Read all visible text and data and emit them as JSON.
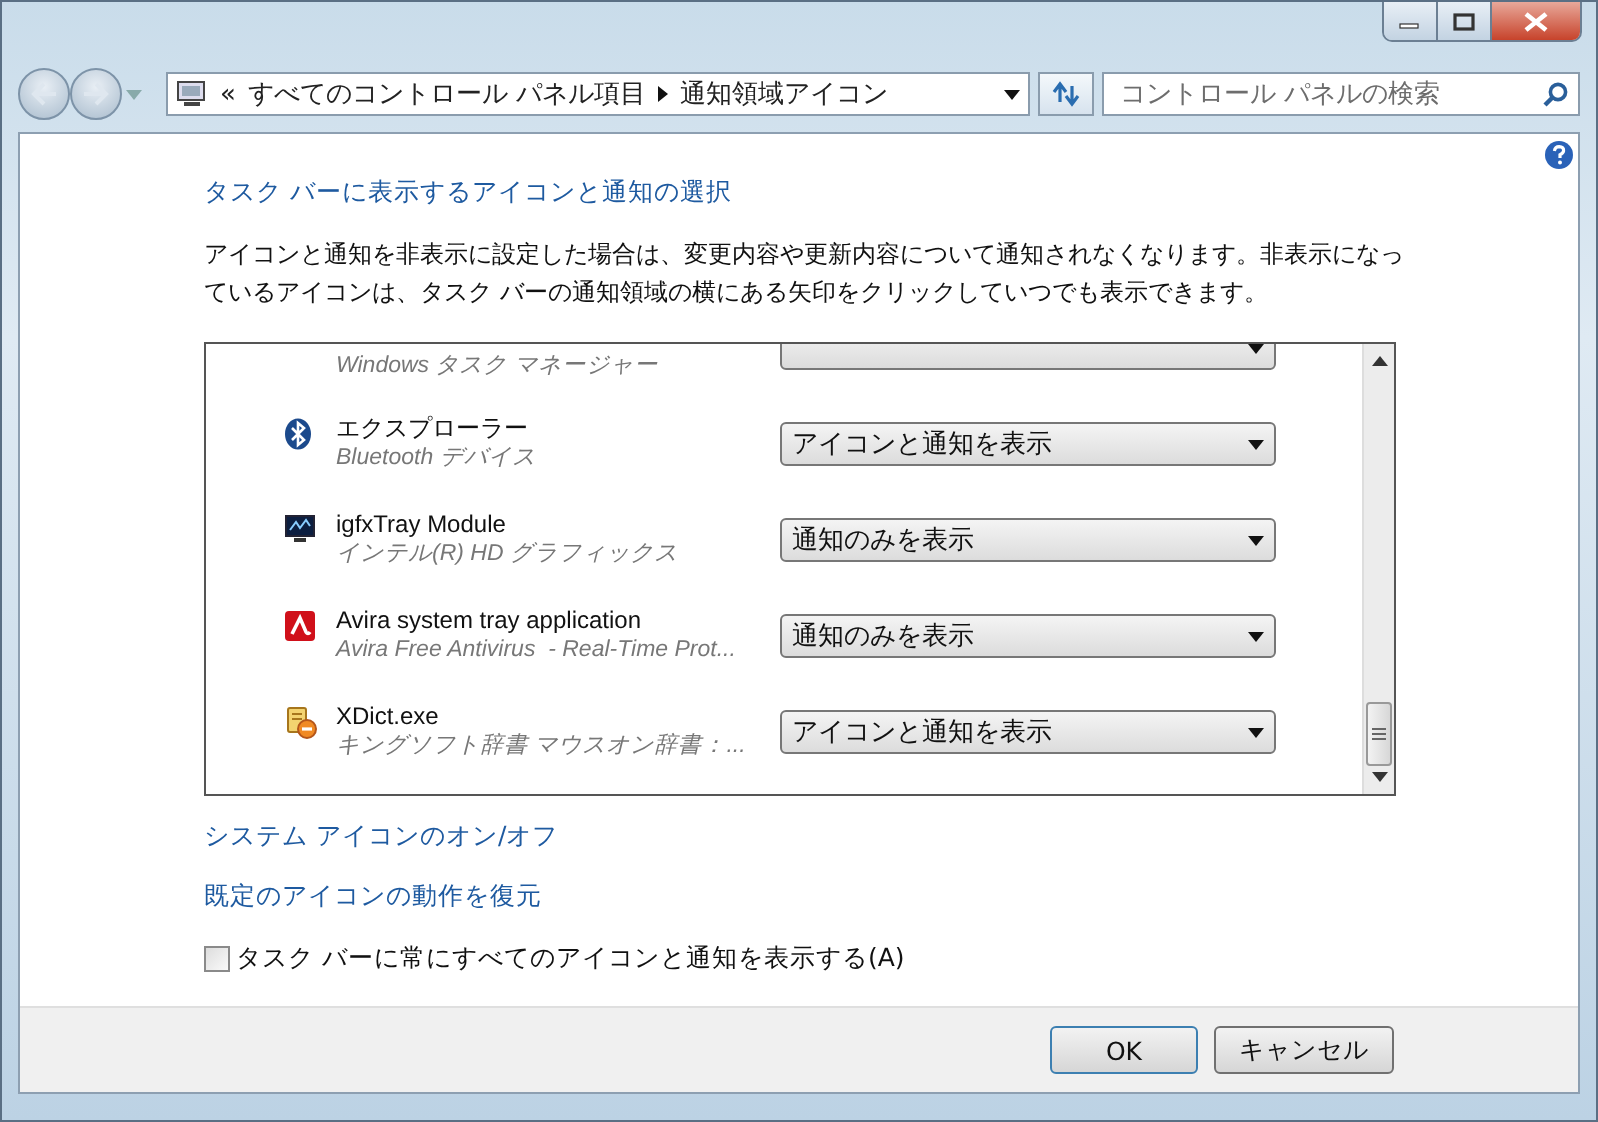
{
  "address_bar": {
    "overflow": "«",
    "crumbs": [
      "すべてのコントロール パネル項目",
      "通知領域アイコン"
    ]
  },
  "search": {
    "placeholder": "コントロール パネルの検索"
  },
  "heading": "タスク バーに表示するアイコンと通知の選択",
  "description": "アイコンと通知を非表示に設定した場合は、変更内容や更新内容について通知されなくなります。非表示になっているアイコンは、タスク バーの通知領域の横にある矢印をクリックしていつでも表示できます。",
  "icons": [
    {
      "kind": "partial",
      "subtitle": "Windows タスク マネージャー"
    },
    {
      "kind": "bluetooth",
      "name": "エクスプローラー",
      "subtitle": "Bluetooth デバイス",
      "behavior": "アイコンと通知を表示"
    },
    {
      "kind": "monitor",
      "name": "igfxTray Module",
      "subtitle": "インテル(R) HD グラフィックス",
      "behavior": "通知のみを表示"
    },
    {
      "kind": "avira",
      "name": "Avira system tray application",
      "subtitle": "Avira Free Antivirus  - Real-Time Prot...",
      "behavior": "通知のみを表示"
    },
    {
      "kind": "dict",
      "name": "XDict.exe",
      "subtitle": "キングソフト辞書 マウスオン辞書：...",
      "behavior": "アイコンと通知を表示"
    }
  ],
  "links": [
    "システム アイコンのオン/オフ",
    "既定のアイコンの動作を復元"
  ],
  "always_show": {
    "label": "タスク バーに常にすべてのアイコンと通知を表示する(A)",
    "checked": false
  },
  "buttons": [
    "OK",
    "キャンセル"
  ]
}
